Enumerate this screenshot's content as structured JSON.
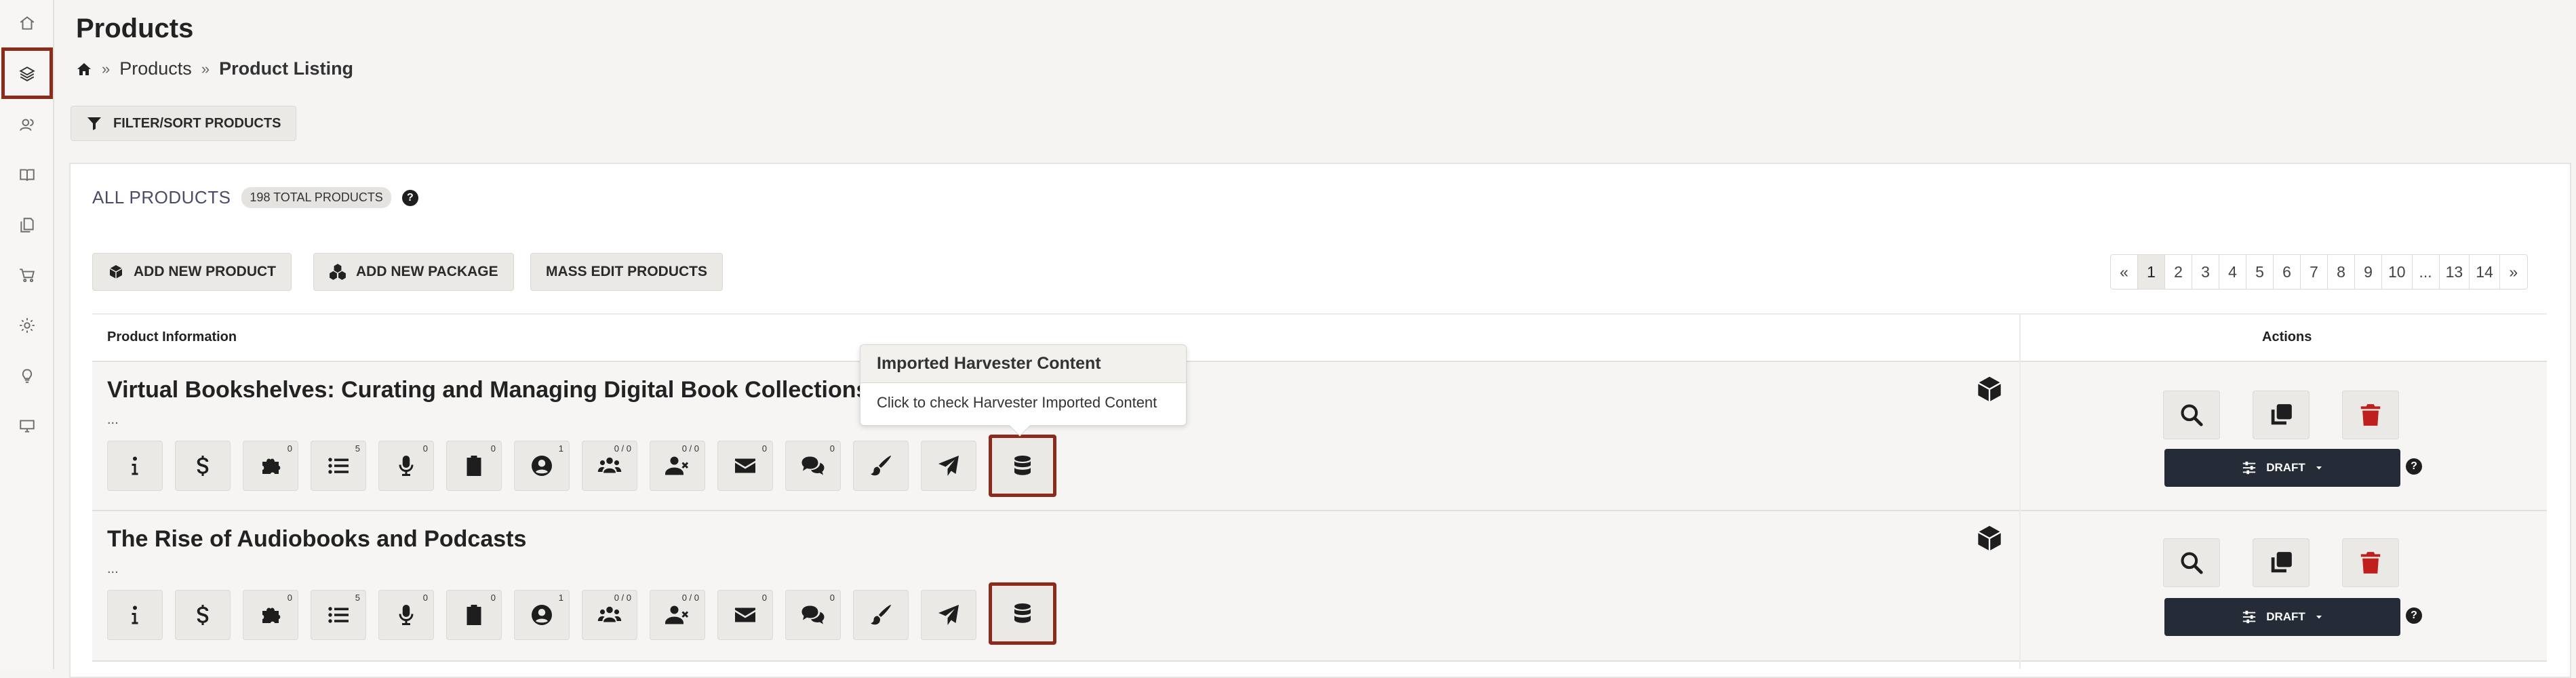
{
  "page_title": "Products",
  "breadcrumb": {
    "separator": "»",
    "items": [
      "Products",
      "Product Listing"
    ]
  },
  "filter_button": "FILTER/SORT PRODUCTS",
  "panel": {
    "title": "ALL PRODUCTS",
    "total_badge": "198 TOTAL PRODUCTS",
    "help": "?"
  },
  "toolbar": {
    "add_product": "ADD NEW PRODUCT",
    "add_package": "ADD NEW PACKAGE",
    "mass_edit": "MASS EDIT PRODUCTS"
  },
  "pagination": {
    "prev": "«",
    "next": "»",
    "pages": [
      "1",
      "2",
      "3",
      "4",
      "5",
      "6",
      "7",
      "8",
      "9",
      "10",
      "...",
      "13",
      "14"
    ],
    "active": "1"
  },
  "table": {
    "col_info": "Product Information",
    "col_actions": "Actions"
  },
  "tooltip": {
    "title": "Imported Harvester Content",
    "body": "Click to check Harvester Imported Content"
  },
  "products": [
    {
      "title": "Virtual Bookshelves: Curating and Managing Digital Book Collections",
      "ellipsis": "...",
      "status": "DRAFT",
      "counts": {
        "extras": "0",
        "chapters": "5",
        "audio": "0",
        "clipboard": "0",
        "contributors": "1",
        "groups": "0 / 0",
        "removed": "0 / 0",
        "messages": "0"
      }
    },
    {
      "title": "The Rise of Audiobooks and Podcasts",
      "ellipsis": "...",
      "status": "DRAFT",
      "counts": {
        "extras": "0",
        "chapters": "5",
        "audio": "0",
        "clipboard": "0",
        "contributors": "1",
        "groups": "0 / 0",
        "removed": "0 / 0",
        "messages": "0"
      }
    }
  ],
  "icons": {
    "sidebar": [
      "home-icon",
      "layers-icon",
      "users-icon",
      "book-icon",
      "documents-icon",
      "cart-icon",
      "gear-icon",
      "lightbulb-icon",
      "monitor-icon"
    ],
    "row": [
      "info-icon",
      "dollar-icon",
      "puzzle-icon",
      "list-icon",
      "microphone-icon",
      "clipboard-icon",
      "user-circle-icon",
      "users-group-icon",
      "user-remove-icon",
      "envelope-icon",
      "comments-icon",
      "brush-icon",
      "paper-plane-icon",
      "database-icon"
    ]
  },
  "colors": {
    "highlight": "#8c2a1c",
    "dark_button": "#262b38",
    "delete": "#c0201d",
    "panel_title": "#4a4c6a"
  }
}
